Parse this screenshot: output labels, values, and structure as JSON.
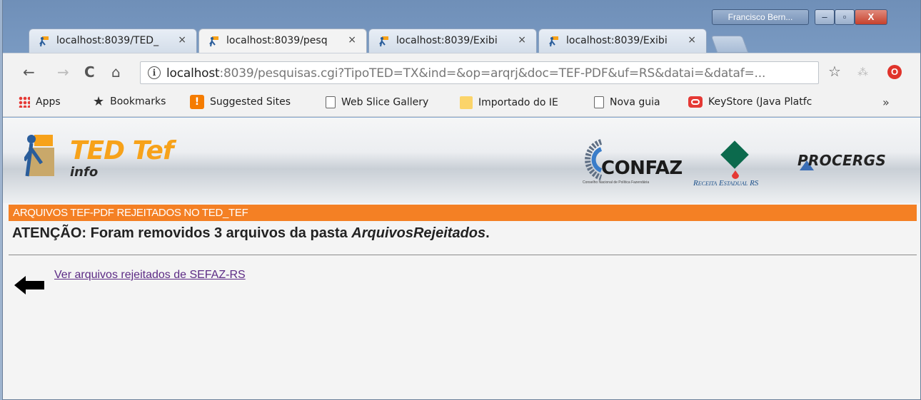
{
  "window": {
    "user_label": "Francisco Bern...",
    "minimize_label": "–",
    "maximize_label": "▫",
    "close_label": "X"
  },
  "tabs": [
    {
      "label": "localhost:8039/TED_",
      "close": "×"
    },
    {
      "label": "localhost:8039/pesq",
      "close": "×"
    },
    {
      "label": "localhost:8039/Exibi",
      "close": "×"
    },
    {
      "label": "localhost:8039/Exibi",
      "close": "×"
    }
  ],
  "toolbar": {
    "back_icon": "←",
    "forward_icon": "→",
    "reload_icon": "C",
    "home_icon": "⌂",
    "info_icon": "i",
    "url_host": "localhost",
    "url_rest": ":8039/pesquisas.cgi?TipoTED=TX&ind=&op=arqrj&doc=TEF-PDF&uf=RS&datai=&dataf=...",
    "star_icon": "☆",
    "ext_icon": "⁂",
    "opera_icon": "O"
  },
  "bookmarks": {
    "items": [
      {
        "label": "Apps"
      },
      {
        "label": "Bookmarks"
      },
      {
        "label": "Suggested Sites"
      },
      {
        "label": "Web Slice Gallery"
      },
      {
        "label": "Importado do IE"
      },
      {
        "label": "Nova guia"
      },
      {
        "label": "KeyStore (Java Platfc"
      }
    ],
    "more": "»"
  },
  "page": {
    "logo_title": "TED Tef",
    "logo_sub": "info",
    "confaz": "CONFAZ",
    "confaz_small": "Conselho Nacional de Política Fazendária",
    "receita": "Receita Estadual RS",
    "procergs": "PROCERGS",
    "header_bar": "ARQUIVOS TEF-PDF REJEITADOS NO TED_TEF",
    "notice_prefix": "ATENÇÃO: Foram removidos 3 arquivos da pasta ",
    "notice_folder": "ArquivosRejeitados",
    "notice_suffix": ".",
    "back_link": "Ver arquivos rejeitados de SEFAZ-RS"
  },
  "colors": {
    "header_bar": "#f48024",
    "link_visited": "#5c2b85",
    "logo_orange": "#f7a21a"
  }
}
